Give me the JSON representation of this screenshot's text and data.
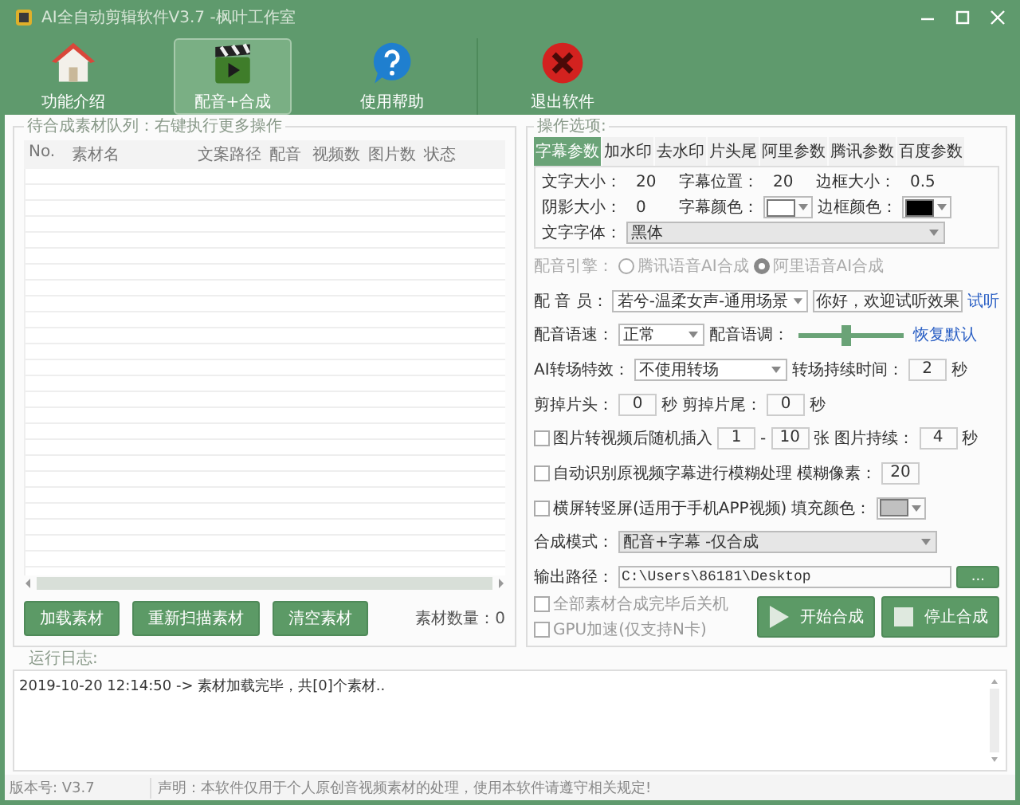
{
  "window": {
    "title": "AI全自动剪辑软件V3.7 -枫叶工作室"
  },
  "toolbar": [
    {
      "label": "功能介绍",
      "selected": false
    },
    {
      "label": "配音+合成",
      "selected": true
    },
    {
      "label": "使用帮助",
      "selected": false
    },
    {
      "label": "退出软件",
      "selected": false
    }
  ],
  "queue": {
    "title": "待合成素材队列：右键执行更多操作",
    "columns": [
      "No.",
      "素材名",
      "文案路径",
      "配音",
      "视频数",
      "图片数",
      "状态"
    ],
    "buttons": [
      "加载素材",
      "重新扫描素材",
      "清空素材"
    ],
    "count": "素材数量：0"
  },
  "options": {
    "title": "操作选项:",
    "tabs": [
      {
        "label": "字幕参数",
        "selected": true
      },
      {
        "label": "加水印",
        "selected": false
      },
      {
        "label": "去水印",
        "selected": false
      },
      {
        "label": "片头尾",
        "selected": false
      },
      {
        "label": "阿里参数",
        "selected": false
      },
      {
        "label": "腾讯参数",
        "selected": false
      },
      {
        "label": "百度参数",
        "selected": false
      }
    ],
    "tab_rows": [
      {
        "items": [
          {
            "kind": "label",
            "text": "文字大小："
          },
          {
            "kind": "value",
            "text": "20"
          },
          {
            "kind": "label",
            "text": "字幕位置："
          },
          {
            "kind": "value",
            "text": "20"
          },
          {
            "kind": "label",
            "text": "边框大小："
          },
          {
            "kind": "value",
            "text": "0.5"
          }
        ]
      },
      {
        "items": [
          {
            "kind": "label",
            "text": "阴影大小："
          },
          {
            "kind": "value",
            "text": "0"
          },
          {
            "kind": "label",
            "text": "字幕颜色："
          },
          {
            "kind": "color",
            "color": "#ffffff"
          },
          {
            "kind": "label",
            "text": "边框颜色："
          },
          {
            "kind": "color",
            "color": "#000000"
          }
        ]
      },
      {
        "items": [
          {
            "kind": "label",
            "text": "文字字体："
          },
          {
            "kind": "long-select",
            "text": "黑体"
          }
        ]
      }
    ],
    "rows": [
      {
        "disabled": true,
        "items": [
          {
            "kind": "label",
            "text": "配音引擎："
          },
          {
            "kind": "radio",
            "text": "腾讯语音AI合成",
            "selected": false
          },
          {
            "kind": "radio",
            "text": "阿里语音AI合成",
            "selected": true
          }
        ]
      },
      {
        "disabled": false,
        "items": [
          {
            "kind": "label",
            "text": "配 音 员："
          },
          {
            "kind": "select",
            "text": "若兮-温柔女声-通用场景"
          },
          {
            "kind": "field",
            "text": "你好，欢迎试听效果"
          },
          {
            "kind": "link",
            "text": "试听"
          }
        ]
      },
      {
        "disabled": false,
        "items": [
          {
            "kind": "label",
            "text": "配音语速："
          },
          {
            "kind": "small-select",
            "text": "正常"
          },
          {
            "kind": "label",
            "text": "配音语调："
          },
          {
            "kind": "slider",
            "level": 0.45
          },
          {
            "kind": "link",
            "text": "恢复默认"
          }
        ]
      },
      {
        "disabled": false,
        "items": [
          {
            "kind": "label",
            "text": "AI转场特效："
          },
          {
            "kind": "select",
            "text": "不使用转场"
          },
          {
            "kind": "label",
            "text": "转场持续时间："
          },
          {
            "kind": "num",
            "text": "2"
          },
          {
            "kind": "label",
            "text": "秒"
          }
        ]
      },
      {
        "disabled": false,
        "items": [
          {
            "kind": "label",
            "text": "剪掉片头："
          },
          {
            "kind": "num",
            "text": "0"
          },
          {
            "kind": "label",
            "text": "秒"
          },
          {
            "kind": "label",
            "text": "剪掉片尾："
          },
          {
            "kind": "num",
            "text": "0"
          },
          {
            "kind": "label",
            "text": "秒"
          }
        ]
      },
      {
        "disabled": false,
        "items": [
          {
            "kind": "check",
            "text": "图片转视频后随机插入",
            "checked": false
          },
          {
            "kind": "num",
            "text": "1"
          },
          {
            "kind": "label",
            "text": "-"
          },
          {
            "kind": "num",
            "text": "10"
          },
          {
            "kind": "label",
            "text": "张"
          },
          {
            "kind": "label",
            "text": "图片持续："
          },
          {
            "kind": "num",
            "text": "4"
          },
          {
            "kind": "label",
            "text": "秒"
          }
        ]
      },
      {
        "disabled": false,
        "items": [
          {
            "kind": "check",
            "text": "自动识别原视频字幕进行模糊处理",
            "checked": false
          },
          {
            "kind": "label",
            "text": "模糊像素："
          },
          {
            "kind": "num",
            "text": "20"
          }
        ]
      },
      {
        "disabled": false,
        "items": [
          {
            "kind": "check",
            "text": "横屏转竖屏(适用于手机APP视频)",
            "checked": false
          },
          {
            "kind": "label",
            "text": "填充颜色："
          },
          {
            "kind": "color",
            "color": "#c0c0c0"
          }
        ]
      },
      {
        "disabled": false,
        "items": [
          {
            "kind": "label",
            "text": "合成模式："
          },
          {
            "kind": "long-select",
            "text": "配音+字幕 -仅合成"
          }
        ]
      },
      {
        "disabled": false,
        "items": [
          {
            "kind": "label",
            "text": "输出路径："
          },
          {
            "kind": "long-field",
            "text": "C:\\Users\\86181\\Desktop"
          },
          {
            "kind": "button",
            "text": "..."
          }
        ]
      }
    ],
    "checks": [
      {
        "text": "全部素材合成完毕后关机",
        "checked": false
      },
      {
        "text": "GPU加速(仅支持N卡)",
        "checked": false
      }
    ],
    "actions": [
      {
        "text": "开始合成"
      },
      {
        "text": "停止合成"
      }
    ]
  },
  "log": {
    "title": "运行日志:",
    "lines": [
      "2019-10-20 12:14:50 -> 素材加载完毕，共[0]个素材.."
    ]
  },
  "status_bar": {
    "version": "版本号: V3.7",
    "notice": "声明：本软件仅用于个人原创音视频素材的处理，使用本软件请遵守相关规定!"
  }
}
